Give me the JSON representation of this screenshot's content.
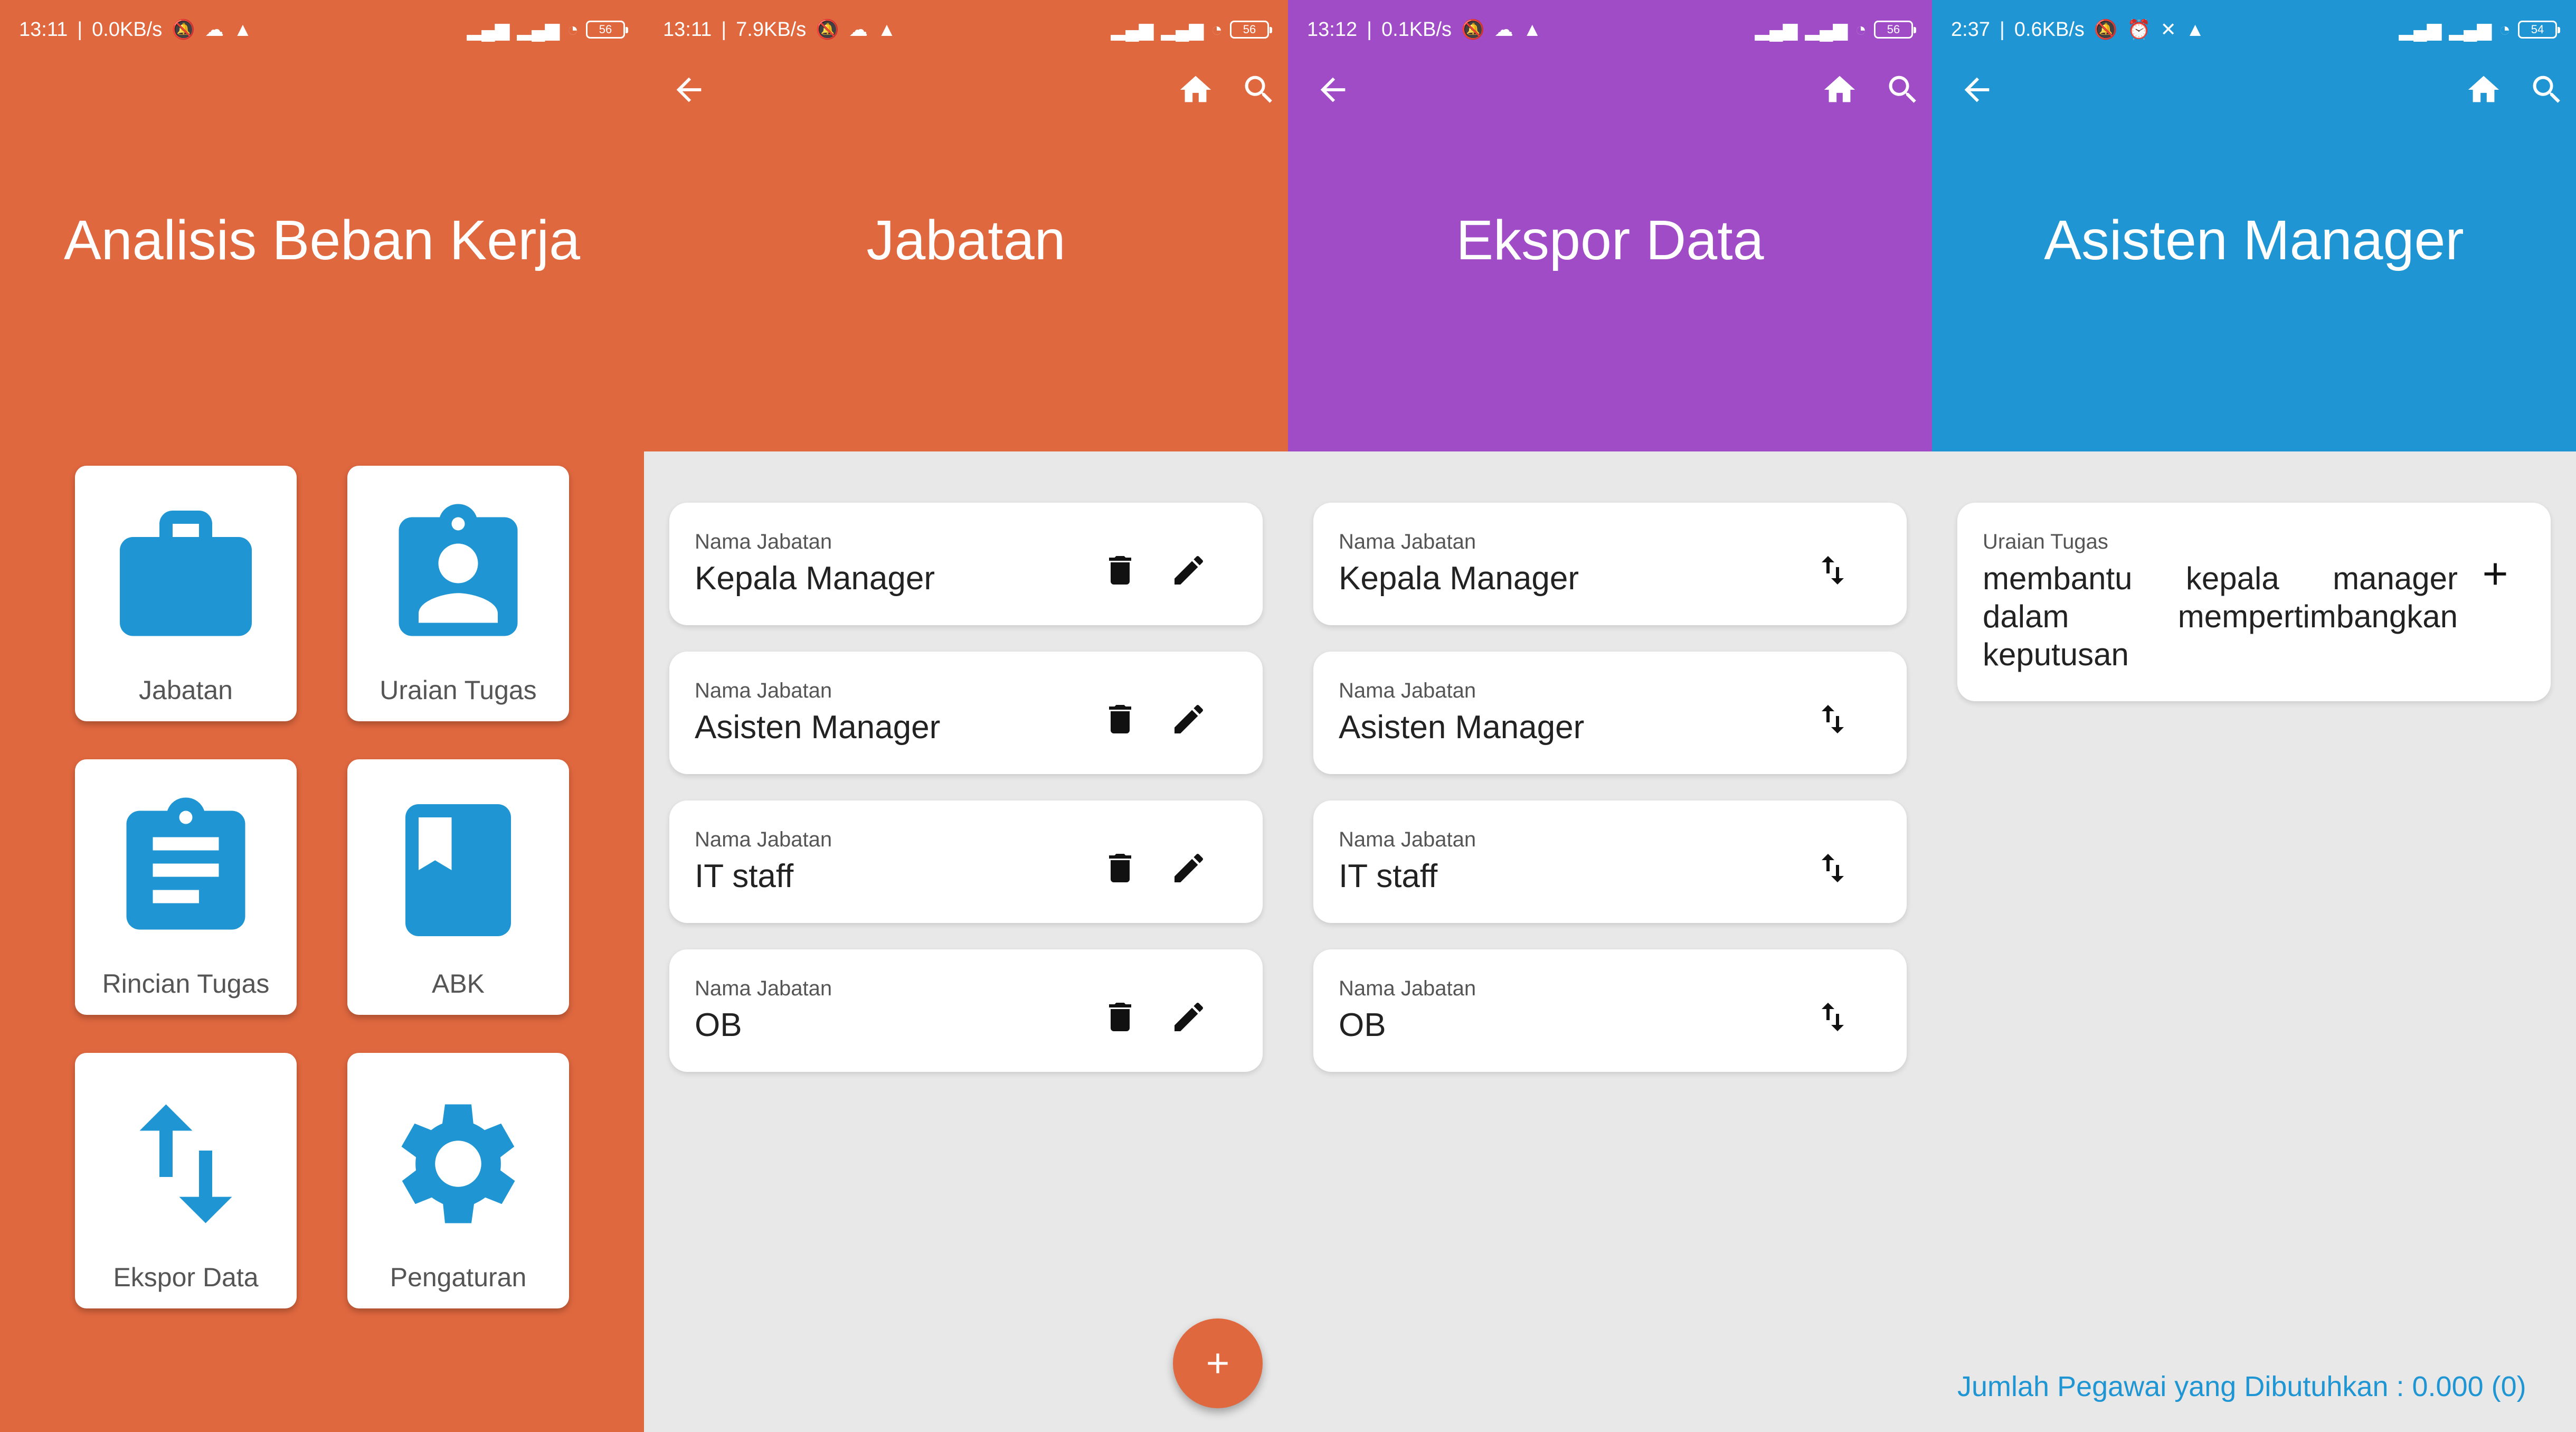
{
  "colors": {
    "orange": "#e0683f",
    "purple": "#a04cc6",
    "blue": "#1f96d3",
    "bg": "#e8e8e8",
    "icon_blue": "#1f96d3"
  },
  "panels": {
    "home": {
      "status": {
        "time": "13:11",
        "speed": "0.0KB/s",
        "battery": "56"
      },
      "title": "Analisis Beban Kerja",
      "tiles": [
        {
          "label": "Jabatan",
          "icon": "briefcase-icon"
        },
        {
          "label": "Uraian Tugas",
          "icon": "id-badge-icon"
        },
        {
          "label": "Rincian Tugas",
          "icon": "clipboard-icon"
        },
        {
          "label": "ABK",
          "icon": "book-icon"
        },
        {
          "label": "Ekspor Data",
          "icon": "swap-vertical-icon"
        },
        {
          "label": "Pengaturan",
          "icon": "gear-icon"
        }
      ]
    },
    "jabatan": {
      "status": {
        "time": "13:11",
        "speed": "7.9KB/s",
        "battery": "56"
      },
      "title": "Jabatan",
      "field_label": "Nama Jabatan",
      "items": [
        "Kepala Manager",
        "Asisten Manager",
        "IT staff",
        "OB"
      ],
      "fab": "+"
    },
    "ekspor": {
      "status": {
        "time": "13:12",
        "speed": "0.1KB/s",
        "battery": "56"
      },
      "title": "Ekspor Data",
      "field_label": "Nama Jabatan",
      "items": [
        "Kepala Manager",
        "Asisten Manager",
        "IT staff",
        "OB"
      ]
    },
    "asisten": {
      "status": {
        "time": "2:37",
        "speed": "0.6KB/s",
        "battery": "54"
      },
      "title": "Asisten Manager",
      "field_label": "Uraian Tugas",
      "task": "membantu kepala manager dalam mempertimbangkan keputusan",
      "footer": "Jumlah Pegawai yang Dibutuhkan : 0.000 (0)"
    }
  }
}
